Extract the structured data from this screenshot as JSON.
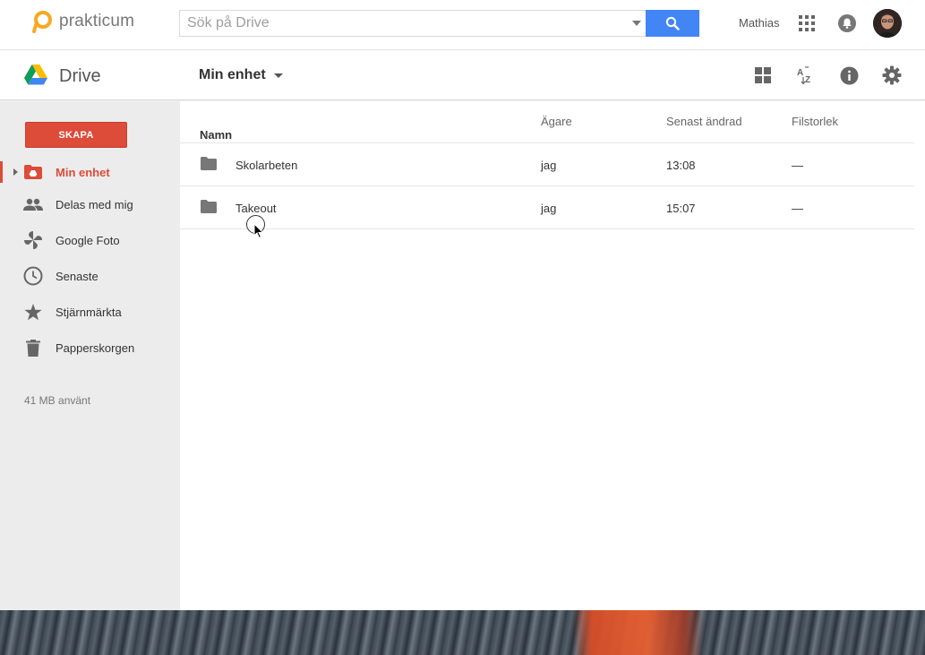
{
  "brand": {
    "name": "prakticum",
    "logo_icon": "prakticum-logo-icon"
  },
  "search": {
    "placeholder": "Sök på Drive",
    "button_icon": "search-icon"
  },
  "user": {
    "name": "Mathias"
  },
  "drive": {
    "title": "Drive"
  },
  "location": {
    "label": "Min enhet"
  },
  "sidebar": {
    "create_label": "SKAPA",
    "items": [
      {
        "label": "Min enhet",
        "icon": "my-drive-icon",
        "active": true
      },
      {
        "label": "Delas med mig",
        "icon": "shared-people-icon",
        "active": false
      },
      {
        "label": "Google Foto",
        "icon": "google-photos-icon",
        "active": false
      },
      {
        "label": "Senaste",
        "icon": "clock-icon",
        "active": false
      },
      {
        "label": "Stjärnmärkta",
        "icon": "star-icon",
        "active": false
      },
      {
        "label": "Papperskorgen",
        "icon": "trash-icon",
        "active": false
      }
    ],
    "quota": "41 MB använt"
  },
  "table": {
    "columns": {
      "name": "Namn",
      "sort_arrow": "↑",
      "owner": "Ägare",
      "modified": "Senast ändrad",
      "size": "Filstorlek"
    },
    "rows": [
      {
        "name": "Skolarbeten",
        "owner": "jag",
        "modified": "13:08",
        "size": "—"
      },
      {
        "name": "Takeout",
        "owner": "jag",
        "modified": "15:07",
        "size": "—"
      }
    ]
  },
  "colors": {
    "accent_red": "#dd4b39",
    "search_blue": "#4285f4",
    "sidebar_bg": "#ececec"
  }
}
